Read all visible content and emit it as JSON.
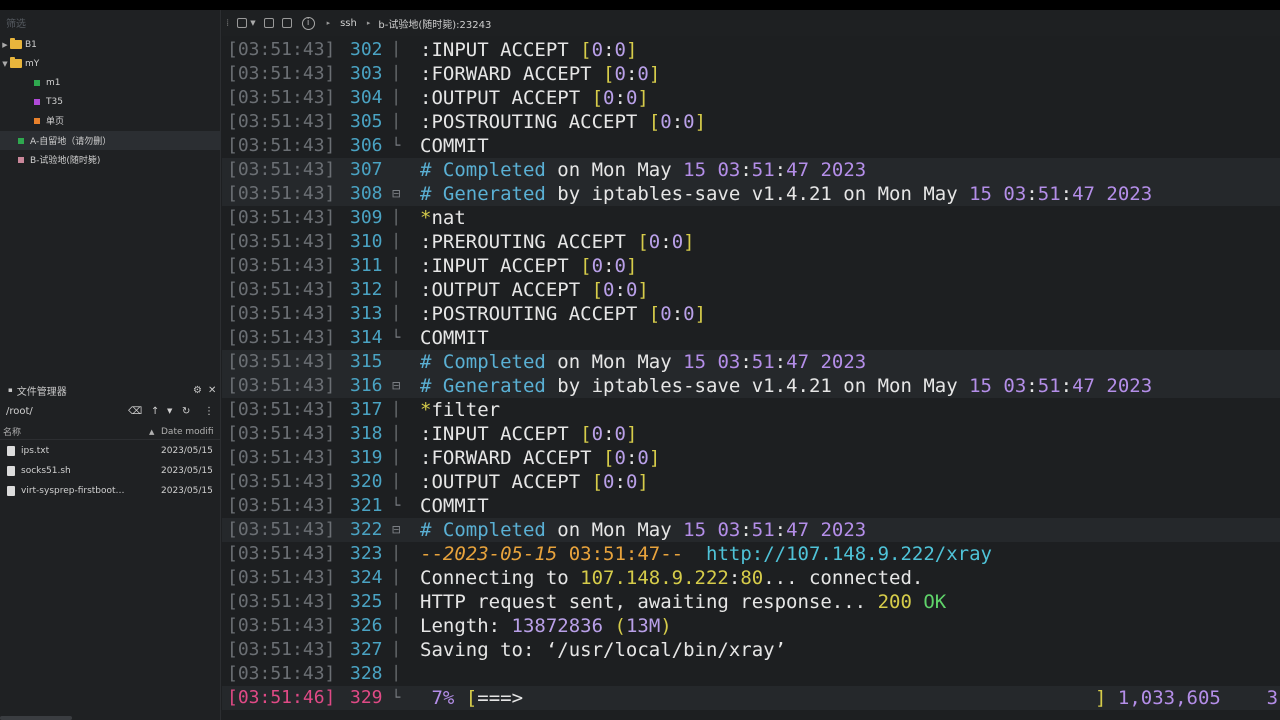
{
  "sidebar": {
    "filter_placeholder": "筛选",
    "tree": [
      {
        "label": "B1",
        "kind": "folder",
        "expanded": false
      },
      {
        "label": "mY",
        "kind": "folder",
        "expanded": true
      },
      {
        "label": "m1",
        "kind": "session",
        "color": "#2fa84f"
      },
      {
        "label": "T35",
        "kind": "session",
        "color": "#b04ad8"
      },
      {
        "label": "单页",
        "kind": "session",
        "color": "#e8812c"
      },
      {
        "label": "A-自留地（请勿删）",
        "kind": "session",
        "color": "#2fa84f"
      },
      {
        "label": "B-试验地(随时毙)",
        "kind": "session",
        "color": "#c9879a"
      }
    ]
  },
  "file_manager": {
    "title": "文件管理器",
    "path": "/root/",
    "col_name": "名称",
    "col_date": "Date modifi",
    "files": [
      {
        "name": "ips.txt",
        "date": "2023/05/15"
      },
      {
        "name": "socks51.sh",
        "date": "2023/05/15"
      },
      {
        "name": "virt-sysprep-firstboot…",
        "date": "2023/05/15"
      }
    ]
  },
  "toolbar": {
    "crumb1": "ssh",
    "crumb2": "b-试验地(随时毙):23243"
  },
  "terminal": {
    "lines": [
      {
        "ts": "[03:51:43]",
        "n": "302",
        "g": "│",
        "html": ":INPUT ACCEPT <span class='c-br'>[</span><span class='c-num'>0</span>:<span class='c-num'>0</span><span class='c-br'>]</span>"
      },
      {
        "ts": "[03:51:43]",
        "n": "303",
        "g": "│",
        "html": ":FORWARD ACCEPT <span class='c-br'>[</span><span class='c-num'>0</span>:<span class='c-num'>0</span><span class='c-br'>]</span>"
      },
      {
        "ts": "[03:51:43]",
        "n": "304",
        "g": "│",
        "html": ":OUTPUT ACCEPT <span class='c-br'>[</span><span class='c-num'>0</span>:<span class='c-num'>0</span><span class='c-br'>]</span>"
      },
      {
        "ts": "[03:51:43]",
        "n": "305",
        "g": "│",
        "html": ":POSTROUTING ACCEPT <span class='c-br'>[</span><span class='c-num'>0</span>:<span class='c-num'>0</span><span class='c-br'>]</span>"
      },
      {
        "ts": "[03:51:43]",
        "n": "306",
        "g": "└",
        "html": "COMMIT"
      },
      {
        "ts": "[03:51:43]",
        "n": "307",
        "g": "",
        "hl": true,
        "html": "<span class='c-cm'># Completed</span> on Mon May <span class='c-dt'>15 03</span>:<span class='c-dt'>51</span>:<span class='c-dt'>47 2023</span>"
      },
      {
        "ts": "[03:51:43]",
        "n": "308",
        "g": "⊟",
        "hl": true,
        "html": "<span class='c-cm'># Generated</span> by iptables-save v1.4.21 on Mon May <span class='c-dt'>15 03</span>:<span class='c-dt'>51</span>:<span class='c-dt'>47 2023</span>"
      },
      {
        "ts": "[03:51:43]",
        "n": "309",
        "g": "│",
        "html": "<span class='c-br'>*</span>nat"
      },
      {
        "ts": "[03:51:43]",
        "n": "310",
        "g": "│",
        "html": ":PREROUTING ACCEPT <span class='c-br'>[</span><span class='c-num'>0</span>:<span class='c-num'>0</span><span class='c-br'>]</span>"
      },
      {
        "ts": "[03:51:43]",
        "n": "311",
        "g": "│",
        "html": ":INPUT ACCEPT <span class='c-br'>[</span><span class='c-num'>0</span>:<span class='c-num'>0</span><span class='c-br'>]</span>"
      },
      {
        "ts": "[03:51:43]",
        "n": "312",
        "g": "│",
        "html": ":OUTPUT ACCEPT <span class='c-br'>[</span><span class='c-num'>0</span>:<span class='c-num'>0</span><span class='c-br'>]</span>"
      },
      {
        "ts": "[03:51:43]",
        "n": "313",
        "g": "│",
        "html": ":POSTROUTING ACCEPT <span class='c-br'>[</span><span class='c-num'>0</span>:<span class='c-num'>0</span><span class='c-br'>]</span>"
      },
      {
        "ts": "[03:51:43]",
        "n": "314",
        "g": "└",
        "html": "COMMIT"
      },
      {
        "ts": "[03:51:43]",
        "n": "315",
        "g": "",
        "hl": true,
        "html": "<span class='c-cm'># Completed</span> on Mon May <span class='c-dt'>15 03</span>:<span class='c-dt'>51</span>:<span class='c-dt'>47 2023</span>"
      },
      {
        "ts": "[03:51:43]",
        "n": "316",
        "g": "⊟",
        "hl": true,
        "html": "<span class='c-cm'># Generated</span> by iptables-save v1.4.21 on Mon May <span class='c-dt'>15 03</span>:<span class='c-dt'>51</span>:<span class='c-dt'>47 2023</span>"
      },
      {
        "ts": "[03:51:43]",
        "n": "317",
        "g": "│",
        "html": "<span class='c-br'>*</span>filter"
      },
      {
        "ts": "[03:51:43]",
        "n": "318",
        "g": "│",
        "html": ":INPUT ACCEPT <span class='c-br'>[</span><span class='c-num'>0</span>:<span class='c-num'>0</span><span class='c-br'>]</span>"
      },
      {
        "ts": "[03:51:43]",
        "n": "319",
        "g": "│",
        "html": ":FORWARD ACCEPT <span class='c-br'>[</span><span class='c-num'>0</span>:<span class='c-num'>0</span><span class='c-br'>]</span>"
      },
      {
        "ts": "[03:51:43]",
        "n": "320",
        "g": "│",
        "html": ":OUTPUT ACCEPT <span class='c-br'>[</span><span class='c-num'>0</span>:<span class='c-num'>0</span><span class='c-br'>]</span>"
      },
      {
        "ts": "[03:51:43]",
        "n": "321",
        "g": "└",
        "html": "COMMIT"
      },
      {
        "ts": "[03:51:43]",
        "n": "322",
        "g": "⊟",
        "hl": true,
        "html": "<span class='c-cm'># Completed</span> on Mon May <span class='c-dt'>15 03</span>:<span class='c-dt'>51</span>:<span class='c-dt'>47 2023</span>"
      },
      {
        "ts": "[03:51:43]",
        "n": "323",
        "g": "│",
        "html": "<span class='c-o'>--<i>2023-05-15</i> 03:51:47--</span>  <span class='c-url'>http://107.148.9.222/xray</span>"
      },
      {
        "ts": "[03:51:43]",
        "n": "324",
        "g": "│",
        "html": "Connecting to <span class='c-br'>107.148.9.222</span>:<span class='c-br'>80</span>... connected."
      },
      {
        "ts": "[03:51:43]",
        "n": "325",
        "g": "│",
        "html": "HTTP request sent, awaiting response... <span class='c-br'>200</span> <span class='c-g'>OK</span>"
      },
      {
        "ts": "[03:51:43]",
        "n": "326",
        "g": "│",
        "html": "Length: <span class='c-num'>13872836</span> <span class='c-br'>(</span><span class='c-num'>13M</span><span class='c-br'>)</span>"
      },
      {
        "ts": "[03:51:43]",
        "n": "327",
        "g": "│",
        "html": "Saving to: ‘/usr/local/bin/xray’"
      },
      {
        "ts": "[03:51:43]",
        "n": "328",
        "g": "│",
        "html": ""
      },
      {
        "ts": "[03:51:46]",
        "n": "329",
        "g": "└",
        "hl": true,
        "current": true,
        "html": " <span class='c-prog'>7%</span> <span class='c-br'>[</span>===&gt;                                                  <span class='c-br'>]</span> <span class='c-prog'>1,033,605</span>    <span class='c-prog'>3</span>"
      }
    ]
  }
}
